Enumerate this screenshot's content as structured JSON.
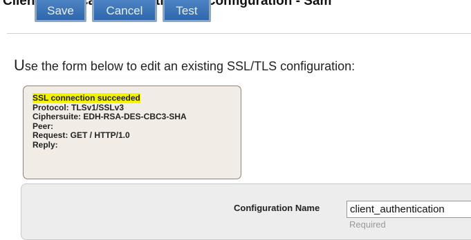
{
  "header": {
    "title": "Client Certificate Authentication Configuration - Sam"
  },
  "toolbar": {
    "save_label": "Save",
    "cancel_label": "Cancel",
    "test_label": "Test"
  },
  "intro": {
    "first_letter": "U",
    "rest": "se the form below to edit an existing SSL/TLS configuration:"
  },
  "status": {
    "result": "SSL connection succeeded",
    "protocol": "Protocol: TLSv1/SSLv3",
    "ciphersuite": "Ciphersuite: EDH-RSA-DES-CBC3-SHA",
    "peer": "Peer:",
    "request": "Request: GET / HTTP/1.0",
    "reply": "Reply:",
    "highlight_color": "#f3f300"
  },
  "form": {
    "config_name_label": "Configuration Name",
    "config_name_value": "client_authentication",
    "config_name_hint": "Required"
  }
}
